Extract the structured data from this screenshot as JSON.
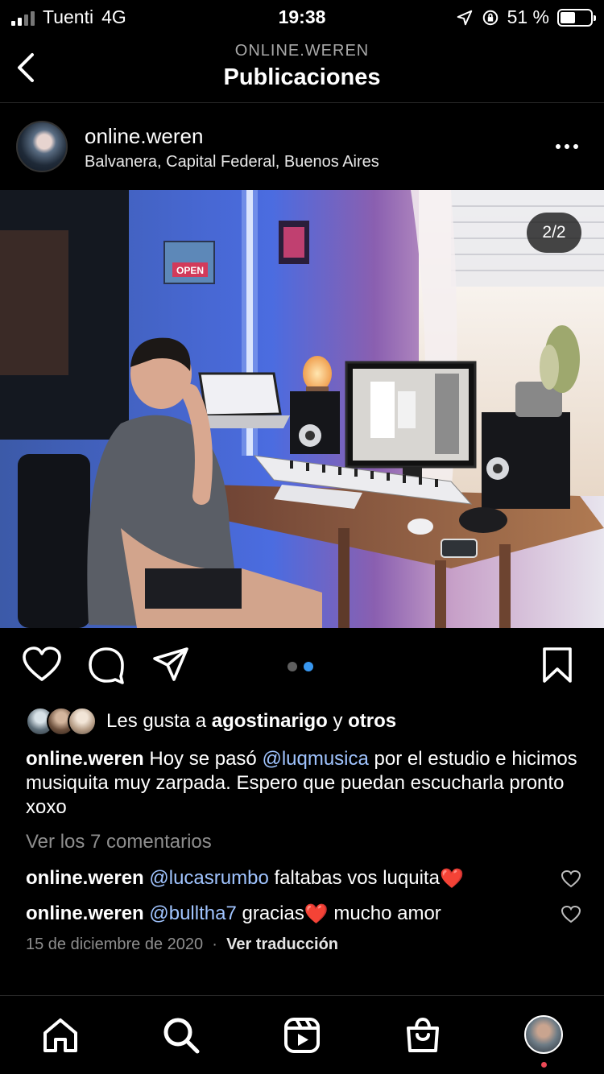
{
  "status_bar": {
    "carrier": "Tuenti",
    "network": "4G",
    "time": "19:38",
    "battery_percent": "51 %",
    "battery_level": 0.51
  },
  "nav": {
    "subtitle": "ONLINE.WEREN",
    "title": "Publicaciones",
    "back_icon": "chevron-left-icon"
  },
  "post": {
    "username": "online.weren",
    "location": "Balvanera, Capital Federal, Buenos Aires",
    "page_indicator": "2/2",
    "image_sign_text": "OPEN",
    "carousel": {
      "count": 2,
      "active_index": 1
    }
  },
  "likes": {
    "prefix": "Les gusta a ",
    "user": "agostinarigo",
    "conj": " y ",
    "others": "otros"
  },
  "caption": {
    "username": "online.weren",
    "text_before": " Hoy se pasó ",
    "mention": "@luqmusica",
    "text_after": " por el estudio e hicimos musiquita muy zarpada. Espero que puedan escucharla pronto xoxo"
  },
  "view_comments": "Ver los 7 comentarios",
  "comments": [
    {
      "username": "online.weren",
      "mention": "@lucasrumbo",
      "text": " faltabas vos luquita",
      "emoji": "❤️"
    },
    {
      "username": "online.weren",
      "mention": "@bulltha7",
      "text": " gracias",
      "emoji": "❤️",
      "text2": " mucho amor"
    }
  ],
  "date": "15 de diciembre de 2020",
  "separator": "·",
  "translate": "Ver traducción",
  "tabs": [
    "home-icon",
    "search-icon",
    "reels-icon",
    "shop-icon",
    "profile-avatar"
  ],
  "colors": {
    "background": "#000000",
    "accent": "#3897f0",
    "mention": "#a0c4ff",
    "muted": "#8e8e8e",
    "notification": "#ed4956"
  }
}
